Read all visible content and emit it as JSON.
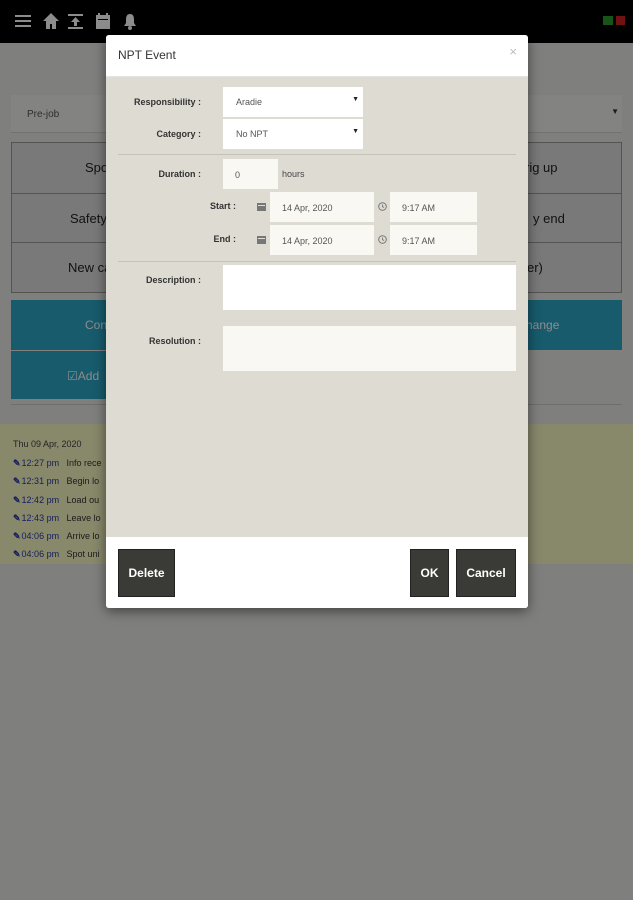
{
  "background": {
    "prejob_label": "Pre-job",
    "grid_buttons": [
      {
        "left": "Spo",
        "right": "rig up"
      },
      {
        "left": "Safety",
        "right": "y end"
      },
      {
        "left": "New ca",
        "right": "er)"
      }
    ],
    "cyan_buttons": {
      "left_top": "Con",
      "right_top": "hange",
      "left_bottom": "Add"
    },
    "log": {
      "date": "Thu 09 Apr, 2020",
      "entries": [
        {
          "time": "12:27 pm",
          "text": "Info rece"
        },
        {
          "time": "12:31 pm",
          "text": "Begin lo"
        },
        {
          "time": "12:42 pm",
          "text": "Load ou"
        },
        {
          "time": "12:43 pm",
          "text": "Leave lo"
        },
        {
          "time": "04:06 pm",
          "text": "Arrive lo"
        },
        {
          "time": "04:06 pm",
          "text": "Spot uni"
        }
      ]
    },
    "accent_color": "#2aa6c6",
    "log_panel_color": "#f7f7c4"
  },
  "modal": {
    "title": "NPT Event",
    "close_glyph": "×",
    "responsibility": {
      "label": "Responsibility :",
      "value": "Aradie"
    },
    "category": {
      "label": "Category :",
      "value": "No NPT"
    },
    "duration": {
      "label": "Duration :",
      "value": "0",
      "unit": "hours"
    },
    "start": {
      "label": "Start :",
      "date": "14 Apr, 2020",
      "time": "9:17 AM"
    },
    "end": {
      "label": "End :",
      "date": "14 Apr, 2020",
      "time": "9:17 AM"
    },
    "description": {
      "label": "Description :",
      "value": ""
    },
    "resolution": {
      "label": "Resolution :",
      "value": ""
    },
    "buttons": {
      "delete": "Delete",
      "ok": "OK",
      "cancel": "Cancel"
    }
  }
}
